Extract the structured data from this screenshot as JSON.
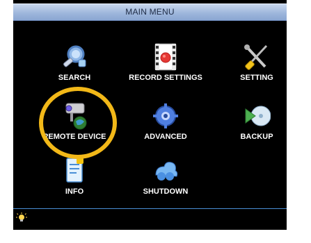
{
  "window": {
    "title": "MAIN MENU"
  },
  "menu": {
    "items": [
      {
        "label": "SEARCH",
        "icon": "search-icon"
      },
      {
        "label": "RECORD SETTINGS",
        "icon": "record-settings-icon"
      },
      {
        "label": "SETTING",
        "icon": "setting-icon"
      },
      {
        "label": "REMOTE DEVICE",
        "icon": "remote-device-icon"
      },
      {
        "label": "ADVANCED",
        "icon": "advanced-icon"
      },
      {
        "label": "BACKUP",
        "icon": "backup-icon"
      },
      {
        "label": "INFO",
        "icon": "info-icon"
      },
      {
        "label": "SHUTDOWN",
        "icon": "shutdown-icon"
      }
    ]
  },
  "status": {
    "icon": "light-bulb-icon"
  },
  "colors": {
    "background": "#000000",
    "titlebar": "#9fb7dc",
    "accent_line": "#4a8fd6",
    "highlight": "#f2b818",
    "text": "#ffffff"
  }
}
